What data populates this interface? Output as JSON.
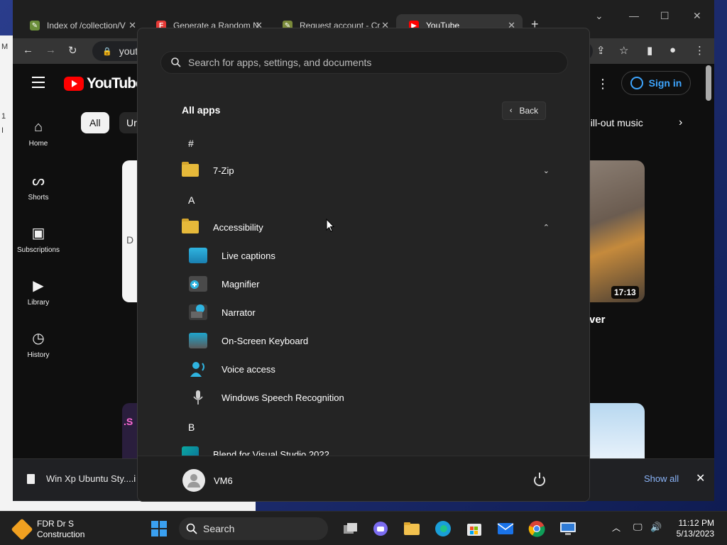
{
  "desktop": {
    "window_fragments": [
      "M",
      "1",
      "I"
    ]
  },
  "browser": {
    "tabs": [
      {
        "title": "Index of /collection/V"
      },
      {
        "title": "Generate a Random N"
      },
      {
        "title": "Request account - Cr"
      },
      {
        "title": "YouTube"
      }
    ],
    "address": "youtu",
    "colors": {
      "youtube_red": "#ff0000",
      "link_blue": "#3ea6ff"
    }
  },
  "youtube": {
    "brand": "YouTube",
    "nav": [
      {
        "label": "Home",
        "icon": "home-icon"
      },
      {
        "label": "Shorts",
        "icon": "shorts-icon"
      },
      {
        "label": "Subscriptions",
        "icon": "subscriptions-icon"
      },
      {
        "label": "Library",
        "icon": "library-icon"
      },
      {
        "label": "History",
        "icon": "history-icon"
      }
    ],
    "chips": {
      "all": "All",
      "partial": "Ur",
      "chill": "hill-out music"
    },
    "sign_in": "Sign in",
    "thumb_left_letter": "D",
    "thumb_left2_text": ".S",
    "duration": "17:13",
    "title_fragment": "ver"
  },
  "downloads": {
    "file_name": "Win Xp Ubuntu Sty....i",
    "show_all": "Show all"
  },
  "start_menu": {
    "search_placeholder": "Search for apps, settings, and documents",
    "title": "All apps",
    "back_label": "Back",
    "letters": {
      "hash": "#",
      "a": "A",
      "b": "B"
    },
    "folders": [
      {
        "label": "7-Zip",
        "expanded": false
      },
      {
        "label": "Accessibility",
        "expanded": true
      }
    ],
    "accessibility_apps": [
      {
        "label": "Live captions",
        "icon": "live-captions-icon"
      },
      {
        "label": "Magnifier",
        "icon": "magnifier-icon"
      },
      {
        "label": "Narrator",
        "icon": "narrator-icon"
      },
      {
        "label": "On-Screen Keyboard",
        "icon": "keyboard-icon"
      },
      {
        "label": "Voice access",
        "icon": "voice-access-icon"
      },
      {
        "label": "Windows Speech Recognition",
        "icon": "microphone-icon"
      }
    ],
    "b_apps": [
      {
        "label": "Blend for Visual Studio 2022",
        "icon": "blend-icon"
      }
    ],
    "user": "VM6"
  },
  "taskbar": {
    "widget_line1": "FDR Dr S",
    "widget_line2": "Construction",
    "search_label": "Search",
    "time": "11:12 PM",
    "date": "5/13/2023",
    "accent": "#3aa0f0"
  }
}
